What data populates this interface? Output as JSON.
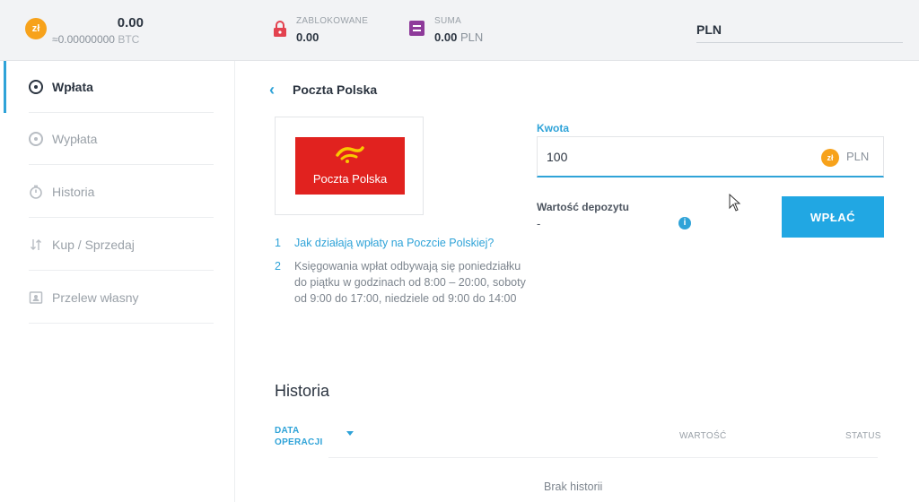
{
  "topbar": {
    "coin_symbol": "zł",
    "balance": "0.00",
    "balance_btc": "≈0.00000000",
    "balance_btc_unit": "BTC",
    "locked_label": "ZABLOKOWANE",
    "locked_value": "0.00",
    "sum_label": "SUMA",
    "sum_value": "0.00",
    "sum_unit": "PLN",
    "currency": "PLN"
  },
  "sidebar": {
    "items": [
      {
        "label": "Wpłata",
        "icon": "deposit-icon",
        "active": true
      },
      {
        "label": "Wypłata",
        "icon": "withdraw-icon",
        "active": false
      },
      {
        "label": "Historia",
        "icon": "stopwatch-icon",
        "active": false
      },
      {
        "label": "Kup / Sprzedaj",
        "icon": "arrows-icon",
        "active": false
      },
      {
        "label": "Przelew własny",
        "icon": "id-card-icon",
        "active": false
      }
    ]
  },
  "main": {
    "title": "Poczta Polska",
    "logo_text": "Poczta Polska",
    "steps": [
      {
        "num": "1",
        "text": "Jak działają wpłaty na Poczcie Polskiej?"
      },
      {
        "num": "2",
        "text": "Księgowania wpłat odbywają się poniedziałku do piątku w godzinach od 8:00 – 20:00, soboty od 9:00 do 17:00, niedziele od 9:00 do 14:00"
      }
    ],
    "form": {
      "amount_label": "Kwota",
      "amount_value": "100",
      "amount_coin": "zł",
      "amount_unit": "PLN",
      "deposit_label": "Wartość depozytu",
      "deposit_value": "-",
      "info_symbol": "i",
      "button_label": "WPŁAĆ"
    },
    "history": {
      "title": "Historia",
      "col_date_line1": "DATA",
      "col_date_line2": "OPERACJI",
      "col_value": "WARTOŚĆ",
      "col_status": "STATUS",
      "empty": "Brak historii"
    }
  },
  "colors": {
    "accent": "#2fa3d8",
    "button": "#21a7e3",
    "coin": "#f7a21b",
    "lock": "#e3424f",
    "sum": "#8e3a9a",
    "logo": "#e1221f"
  }
}
